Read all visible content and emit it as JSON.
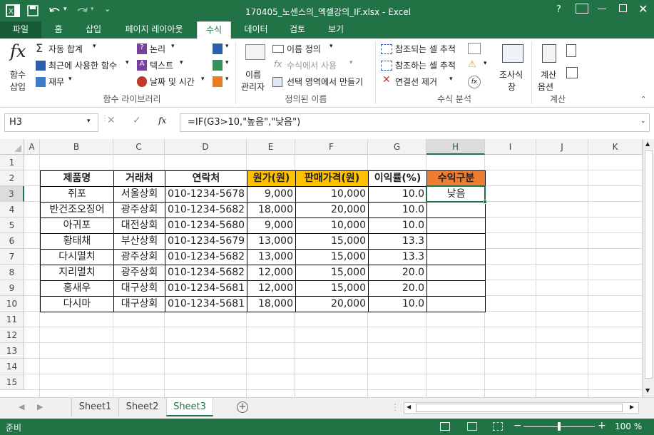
{
  "window": {
    "title": "170405_노센스의_엑셀강의_IF.xlsx - Excel",
    "help": "?"
  },
  "tabs": [
    "파일",
    "홈",
    "삽입",
    "페이지 레이아웃",
    "수식",
    "데이터",
    "검토",
    "보기"
  ],
  "ribbon": {
    "insert_function": {
      "line1": "함수",
      "line2": "삽입"
    },
    "func_lib": {
      "autosum": "자동 합계",
      "recent": "최근에 사용한 함수",
      "financial": "재무",
      "logical": "논리",
      "text": "텍스트",
      "datetime": "날짜 및 시간",
      "group_label": "함수 라이브러리"
    },
    "names": {
      "manager_line1": "이름",
      "manager_line2": "관리자",
      "define": "이름 정의",
      "use_in_formula": "수식에서 사용",
      "create_from_sel": "선택 영역에서 만들기",
      "group_label": "정의된 이름"
    },
    "audit": {
      "trace_precedents": "참조되는 셀 추적",
      "trace_dependents": "참조하는 셀 추적",
      "remove_arrows": "연결선 제거",
      "watch_line1": "조사식",
      "watch_line2": "창",
      "group_label": "수식 분석"
    },
    "calc": {
      "options_line1": "계산",
      "options_line2": "옵션",
      "group_label": "계산"
    }
  },
  "formula_bar": {
    "name_box": "H3",
    "fx": "fx",
    "formula": "=IF(G3>10,\"높음\",\"낮음\")"
  },
  "columns": [
    "A",
    "B",
    "C",
    "D",
    "E",
    "F",
    "G",
    "H",
    "I",
    "J",
    "K"
  ],
  "rows": [
    "1",
    "2",
    "3",
    "4",
    "5",
    "6",
    "7",
    "8",
    "9",
    "10",
    "11",
    "12",
    "13",
    "14",
    "15"
  ],
  "table": {
    "headers": [
      "제품명",
      "거래처",
      "연락처",
      "원가(원)",
      "판매가격(원)",
      "이익률(%)",
      "수익구분"
    ],
    "rows": [
      [
        "쥐포",
        "서울상회",
        "010-1234-5678",
        "9,000",
        "10,000",
        "10.0",
        "낮음"
      ],
      [
        "반건조오징어",
        "광주상회",
        "010-1234-5682",
        "18,000",
        "20,000",
        "10.0",
        ""
      ],
      [
        "아귀포",
        "대전상회",
        "010-1234-5680",
        "9,000",
        "10,000",
        "10.0",
        ""
      ],
      [
        "황태채",
        "부산상회",
        "010-1234-5679",
        "13,000",
        "15,000",
        "13.3",
        ""
      ],
      [
        "다시멸치",
        "광주상회",
        "010-1234-5682",
        "13,000",
        "15,000",
        "13.3",
        ""
      ],
      [
        "지리멸치",
        "광주상회",
        "010-1234-5682",
        "12,000",
        "15,000",
        "20.0",
        ""
      ],
      [
        "홍새우",
        "대구상회",
        "010-1234-5681",
        "12,000",
        "15,000",
        "20.0",
        ""
      ],
      [
        "다시마",
        "대구상회",
        "010-1234-5681",
        "18,000",
        "20,000",
        "10.0",
        ""
      ]
    ]
  },
  "sheets": [
    "Sheet1",
    "Sheet2",
    "Sheet3"
  ],
  "active_sheet": "Sheet3",
  "status": {
    "ready": "준비",
    "zoom": "100 %"
  },
  "colors": {
    "excel_green": "#217346",
    "yellow_header": "#ffc000",
    "orange_header": "#ed7d31"
  }
}
